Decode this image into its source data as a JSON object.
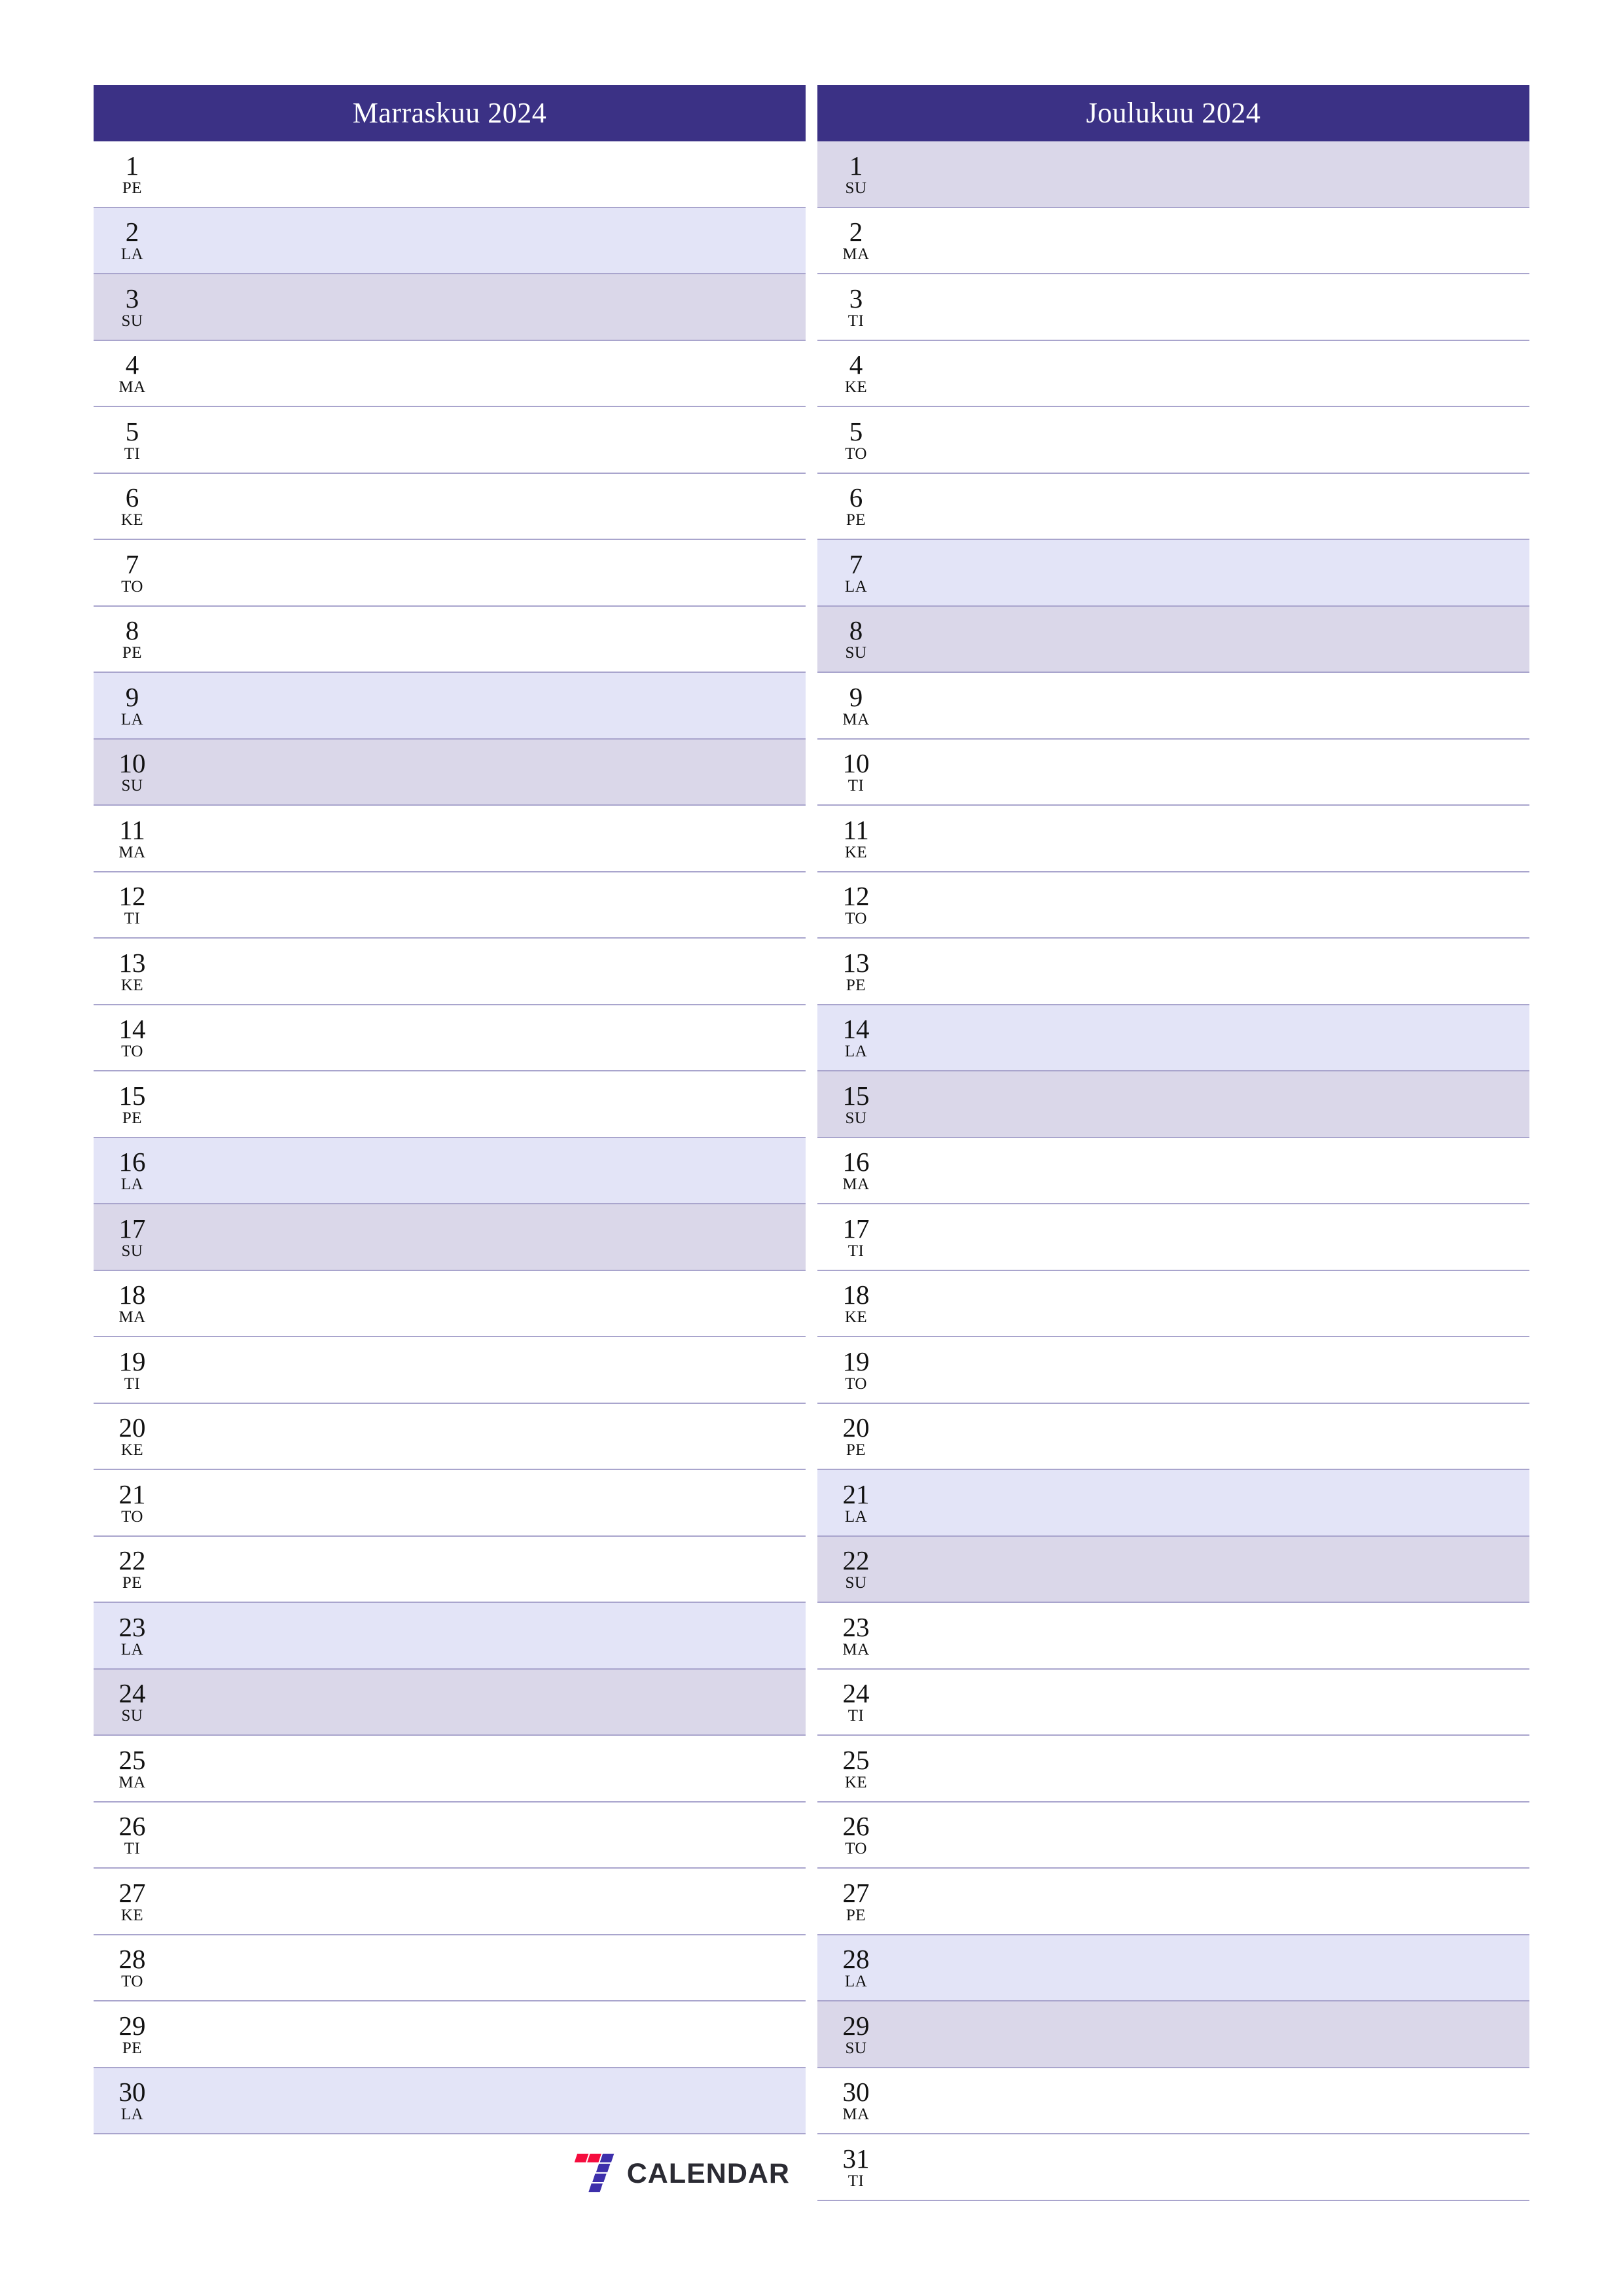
{
  "document": {
    "kind": "monthly-planner",
    "language": "fi",
    "paper": "A4-portrait"
  },
  "theme": {
    "header_bg": "#3b3185",
    "header_text": "#ffffff",
    "row_border": "#a9a5cd",
    "saturday_bg": "#e3e4f7",
    "sunday_bg": "#dad7e9",
    "weekday_bg": "#ffffff",
    "text": "#121212",
    "logo_red": "#f50d3e",
    "logo_purple": "#3d2fab",
    "logo_text": "#2b2b33"
  },
  "weekday_abbreviations": {
    "monday": "MA",
    "tuesday": "TI",
    "wednesday": "KE",
    "thursday": "TO",
    "friday": "PE",
    "saturday": "LA",
    "sunday": "SU"
  },
  "months": [
    {
      "title": "Marraskuu 2024",
      "name": "Marraskuu",
      "year": "2024",
      "days_count": 30,
      "days": [
        {
          "num": "1",
          "dow": "PE",
          "type": "weekday"
        },
        {
          "num": "2",
          "dow": "LA",
          "type": "sat"
        },
        {
          "num": "3",
          "dow": "SU",
          "type": "sun"
        },
        {
          "num": "4",
          "dow": "MA",
          "type": "weekday"
        },
        {
          "num": "5",
          "dow": "TI",
          "type": "weekday"
        },
        {
          "num": "6",
          "dow": "KE",
          "type": "weekday"
        },
        {
          "num": "7",
          "dow": "TO",
          "type": "weekday"
        },
        {
          "num": "8",
          "dow": "PE",
          "type": "weekday"
        },
        {
          "num": "9",
          "dow": "LA",
          "type": "sat"
        },
        {
          "num": "10",
          "dow": "SU",
          "type": "sun"
        },
        {
          "num": "11",
          "dow": "MA",
          "type": "weekday"
        },
        {
          "num": "12",
          "dow": "TI",
          "type": "weekday"
        },
        {
          "num": "13",
          "dow": "KE",
          "type": "weekday"
        },
        {
          "num": "14",
          "dow": "TO",
          "type": "weekday"
        },
        {
          "num": "15",
          "dow": "PE",
          "type": "weekday"
        },
        {
          "num": "16",
          "dow": "LA",
          "type": "sat"
        },
        {
          "num": "17",
          "dow": "SU",
          "type": "sun"
        },
        {
          "num": "18",
          "dow": "MA",
          "type": "weekday"
        },
        {
          "num": "19",
          "dow": "TI",
          "type": "weekday"
        },
        {
          "num": "20",
          "dow": "KE",
          "type": "weekday"
        },
        {
          "num": "21",
          "dow": "TO",
          "type": "weekday"
        },
        {
          "num": "22",
          "dow": "PE",
          "type": "weekday"
        },
        {
          "num": "23",
          "dow": "LA",
          "type": "sat"
        },
        {
          "num": "24",
          "dow": "SU",
          "type": "sun"
        },
        {
          "num": "25",
          "dow": "MA",
          "type": "weekday"
        },
        {
          "num": "26",
          "dow": "TI",
          "type": "weekday"
        },
        {
          "num": "27",
          "dow": "KE",
          "type": "weekday"
        },
        {
          "num": "28",
          "dow": "TO",
          "type": "weekday"
        },
        {
          "num": "29",
          "dow": "PE",
          "type": "weekday"
        },
        {
          "num": "30",
          "dow": "LA",
          "type": "sat"
        }
      ]
    },
    {
      "title": "Joulukuu 2024",
      "name": "Joulukuu",
      "year": "2024",
      "days_count": 31,
      "days": [
        {
          "num": "1",
          "dow": "SU",
          "type": "sun"
        },
        {
          "num": "2",
          "dow": "MA",
          "type": "weekday"
        },
        {
          "num": "3",
          "dow": "TI",
          "type": "weekday"
        },
        {
          "num": "4",
          "dow": "KE",
          "type": "weekday"
        },
        {
          "num": "5",
          "dow": "TO",
          "type": "weekday"
        },
        {
          "num": "6",
          "dow": "PE",
          "type": "weekday"
        },
        {
          "num": "7",
          "dow": "LA",
          "type": "sat"
        },
        {
          "num": "8",
          "dow": "SU",
          "type": "sun"
        },
        {
          "num": "9",
          "dow": "MA",
          "type": "weekday"
        },
        {
          "num": "10",
          "dow": "TI",
          "type": "weekday"
        },
        {
          "num": "11",
          "dow": "KE",
          "type": "weekday"
        },
        {
          "num": "12",
          "dow": "TO",
          "type": "weekday"
        },
        {
          "num": "13",
          "dow": "PE",
          "type": "weekday"
        },
        {
          "num": "14",
          "dow": "LA",
          "type": "sat"
        },
        {
          "num": "15",
          "dow": "SU",
          "type": "sun"
        },
        {
          "num": "16",
          "dow": "MA",
          "type": "weekday"
        },
        {
          "num": "17",
          "dow": "TI",
          "type": "weekday"
        },
        {
          "num": "18",
          "dow": "KE",
          "type": "weekday"
        },
        {
          "num": "19",
          "dow": "TO",
          "type": "weekday"
        },
        {
          "num": "20",
          "dow": "PE",
          "type": "weekday"
        },
        {
          "num": "21",
          "dow": "LA",
          "type": "sat"
        },
        {
          "num": "22",
          "dow": "SU",
          "type": "sun"
        },
        {
          "num": "23",
          "dow": "MA",
          "type": "weekday"
        },
        {
          "num": "24",
          "dow": "TI",
          "type": "weekday"
        },
        {
          "num": "25",
          "dow": "KE",
          "type": "weekday"
        },
        {
          "num": "26",
          "dow": "TO",
          "type": "weekday"
        },
        {
          "num": "27",
          "dow": "PE",
          "type": "weekday"
        },
        {
          "num": "28",
          "dow": "LA",
          "type": "sat"
        },
        {
          "num": "29",
          "dow": "SU",
          "type": "sun"
        },
        {
          "num": "30",
          "dow": "MA",
          "type": "weekday"
        },
        {
          "num": "31",
          "dow": "TI",
          "type": "weekday"
        }
      ]
    }
  ],
  "branding": {
    "logo_mark_name": "seven-slash-icon",
    "logo_text": "CALENDAR"
  }
}
